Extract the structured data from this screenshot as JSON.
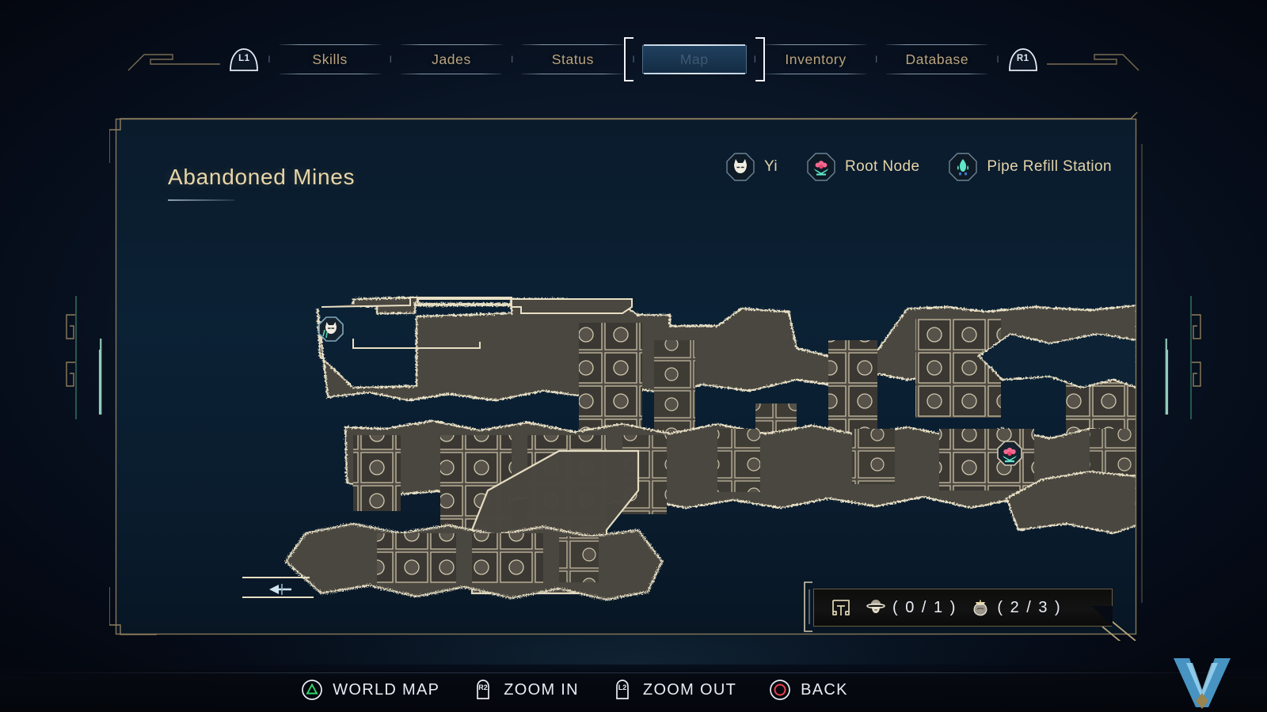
{
  "screen": {
    "name": "map-screen"
  },
  "tabs": {
    "left_bumper": "L1",
    "right_bumper": "R1",
    "separator": "I",
    "items": [
      {
        "label": "Skills",
        "active": false
      },
      {
        "label": "Jades",
        "active": false
      },
      {
        "label": "Status",
        "active": false
      },
      {
        "label": "Map",
        "active": true
      },
      {
        "label": "Inventory",
        "active": false
      },
      {
        "label": "Database",
        "active": false
      }
    ]
  },
  "map": {
    "title": "Abandoned Mines",
    "legend": [
      {
        "icon": "cat-head-icon",
        "label": "Yi"
      },
      {
        "icon": "flower-icon",
        "label": "Root Node"
      },
      {
        "icon": "pipe-flask-icon",
        "label": "Pipe Refill Station"
      }
    ],
    "markers": [
      {
        "icon": "cat-head-icon",
        "name": "player-marker-yi"
      },
      {
        "icon": "flower-icon",
        "name": "root-node-marker"
      }
    ],
    "exit_arrow": "left-exit-arrow"
  },
  "hud": {
    "map_icon": "map-frame-icon",
    "counters": [
      {
        "icon": "lantern-hat-icon",
        "value": "( 0 / 1 )"
      },
      {
        "icon": "coin-pouch-icon",
        "value": "( 2 / 3 )"
      }
    ]
  },
  "actions": [
    {
      "button": "triangle-button",
      "label": "WORLD MAP"
    },
    {
      "button": "r2-trigger",
      "label": "ZOOM IN"
    },
    {
      "button": "l2-trigger",
      "label": "ZOOM OUT"
    },
    {
      "button": "circle-button",
      "label": "BACK"
    }
  ],
  "colors": {
    "gold": "#b9a580",
    "gold_light": "#e8d6a8",
    "terrain_outline": "#e8dfc4",
    "terrain_fill": "#4a4640",
    "accent_pink": "#f2688f",
    "accent_teal": "#5fe8c8",
    "triangle_green": "#2ad66e",
    "circle_red": "#e8414a",
    "map_bg": "#0b2134"
  }
}
